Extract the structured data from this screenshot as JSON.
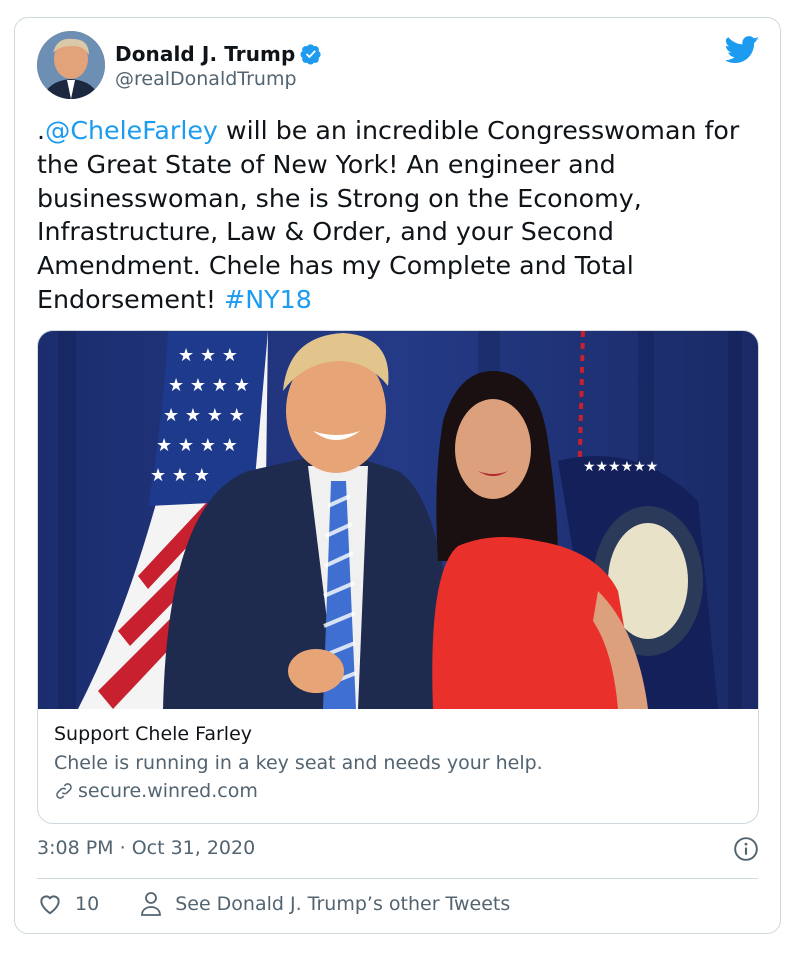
{
  "author": {
    "name": "Donald J. Trump",
    "handle": "@realDonaldTrump",
    "verified_icon": "verified-badge-icon"
  },
  "tweet": {
    "prefix": ".",
    "mention": "@CheleFarley",
    "body": " will be an incredible Congresswoman for the Great State of New York! An engineer and businesswoman, she is Strong on the Economy, Infrastructure, Law & Order, and your Second Amendment. Chele has my Complete and Total Endorsement! ",
    "hashtag": "#NY18"
  },
  "link_card": {
    "title": "Support Chele Farley",
    "description": "Chele is running in a key seat and needs your help.",
    "url": "secure.winred.com"
  },
  "meta": {
    "time": "3:08 PM",
    "separator": " · ",
    "date": "Oct 31, 2020"
  },
  "actions": {
    "likes": "10",
    "other_tweets": "See Donald J. Trump’s other Tweets"
  },
  "colors": {
    "accent": "#1d9bf0",
    "secondary_text": "#536471",
    "border": "#cfd9de"
  }
}
